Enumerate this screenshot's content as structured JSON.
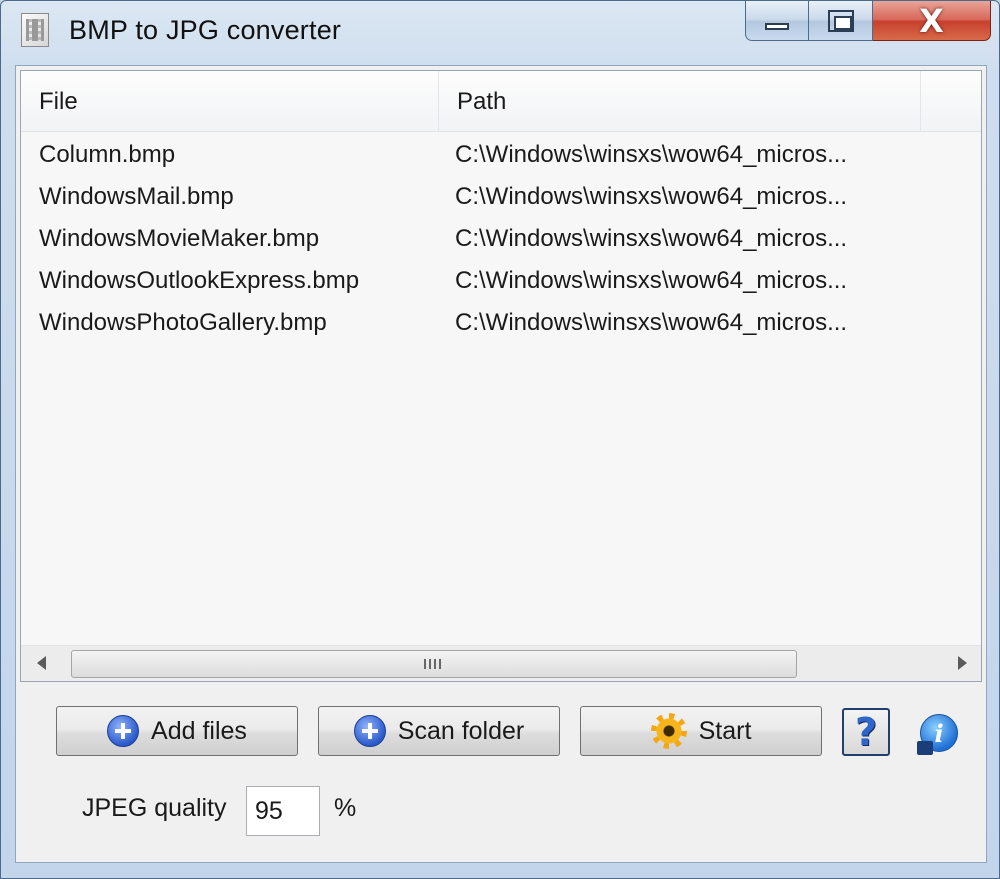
{
  "window": {
    "title": "BMP to JPG converter",
    "close_symbol": "X"
  },
  "list": {
    "columns": [
      "File",
      "Path"
    ],
    "rows": [
      {
        "file": "Column.bmp",
        "path": "C:\\Windows\\winsxs\\wow64_micros..."
      },
      {
        "file": "WindowsMail.bmp",
        "path": "C:\\Windows\\winsxs\\wow64_micros..."
      },
      {
        "file": "WindowsMovieMaker.bmp",
        "path": "C:\\Windows\\winsxs\\wow64_micros..."
      },
      {
        "file": "WindowsOutlookExpress.bmp",
        "path": "C:\\Windows\\winsxs\\wow64_micros..."
      },
      {
        "file": "WindowsPhotoGallery.bmp",
        "path": "C:\\Windows\\winsxs\\wow64_micros..."
      }
    ]
  },
  "toolbar": {
    "add_files_label": "Add files",
    "scan_folder_label": "Scan folder",
    "start_label": "Start",
    "help_symbol": "?",
    "info_symbol": "i"
  },
  "quality": {
    "label": "JPEG quality",
    "value": "95",
    "unit": "%"
  },
  "icons": {
    "app": "app-icon",
    "add": "plus-circle-icon",
    "scan": "plus-circle-icon",
    "start": "gear-icon",
    "help": "help-icon",
    "info": "info-icon"
  }
}
